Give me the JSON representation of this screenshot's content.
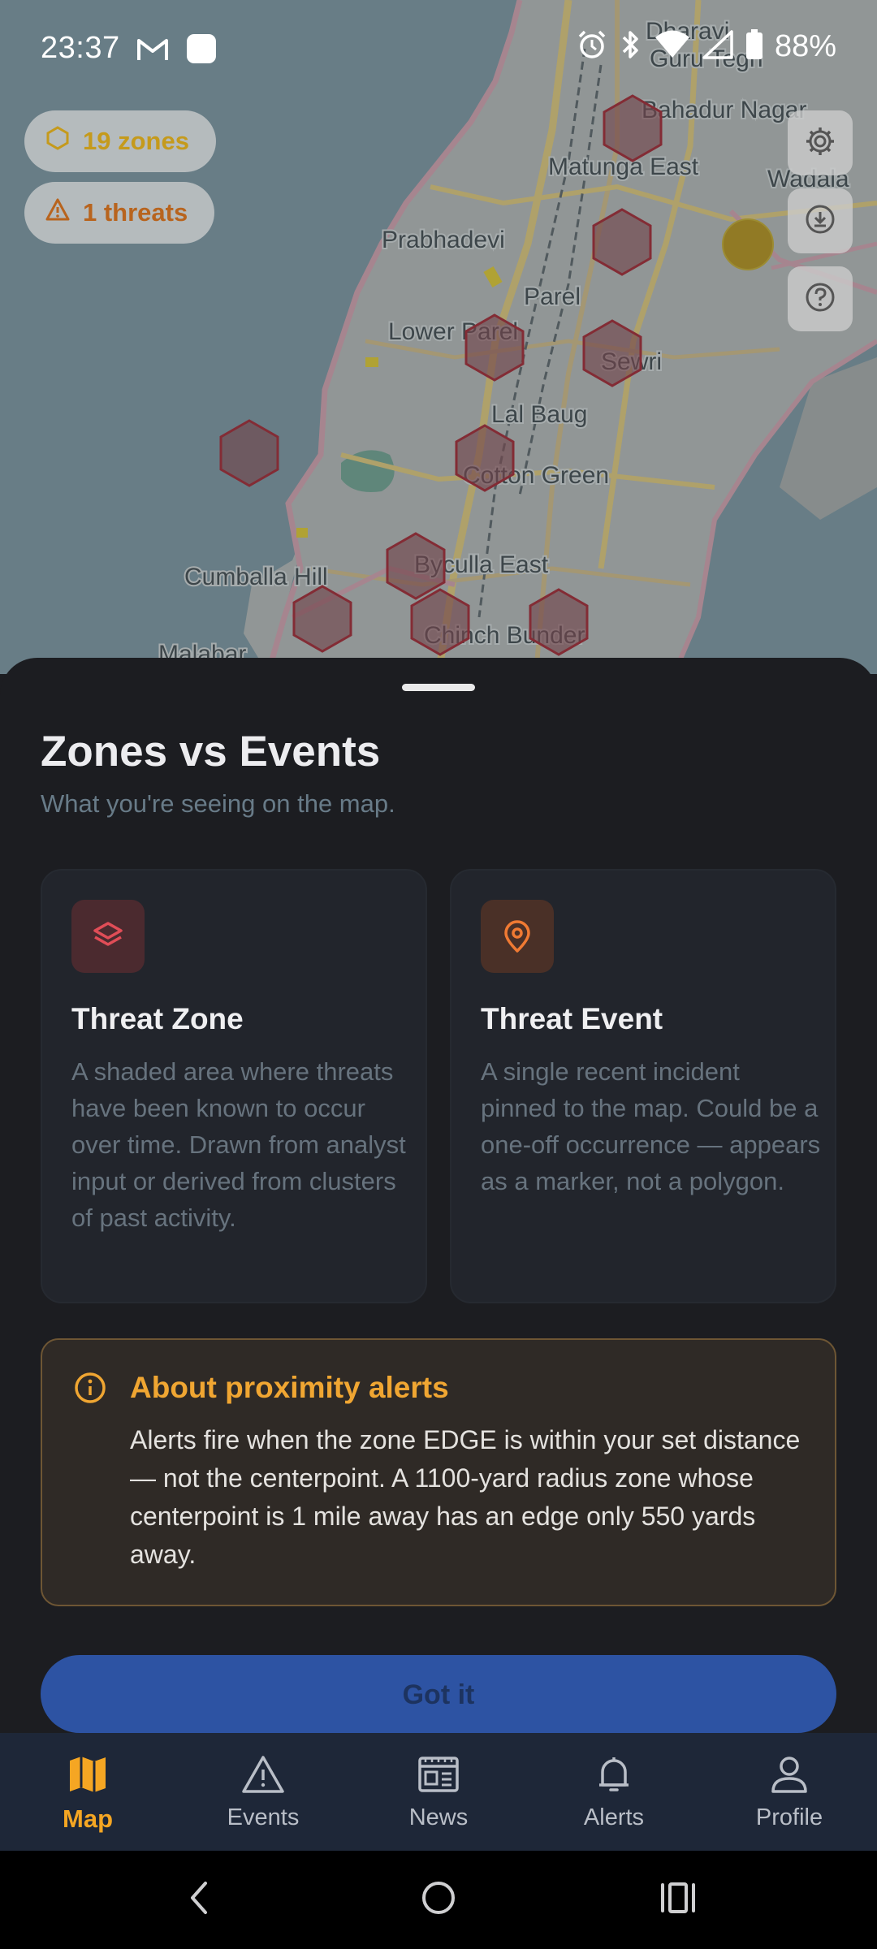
{
  "status_bar": {
    "time": "23:37",
    "battery": "88%"
  },
  "map": {
    "chips": {
      "zones": "19 zones",
      "threats": "1 threats"
    },
    "place_labels": [
      "Dharavi",
      "Guru Tegh",
      "Bahadur Nagar",
      "Matunga East",
      "Wadala",
      "Prabhadevi",
      "Parel",
      "Lower Parel",
      "Sewri",
      "Lal Baug",
      "Cotton Green",
      "Byculla East",
      "Cumballa Hill",
      "Chinch Bunder",
      "Malabar"
    ],
    "colors": {
      "zone_fill": "#8a3a3e",
      "zone_stroke": "#a4151d",
      "event_marker": "#b98a05"
    }
  },
  "sheet": {
    "title": "Zones vs Events",
    "subtitle": "What you're seeing on the map.",
    "cards": {
      "zone": {
        "icon": "layers-icon",
        "title": "Threat Zone",
        "body": "A shaded area where threats have been known to occur over time. Drawn from analyst input or derived from clusters of past activity."
      },
      "event": {
        "icon": "map-pin-icon",
        "title": "Threat Event",
        "body": "A single recent incident pinned to the map. Could be a one-off occurrence — appears as a marker, not a polygon."
      }
    },
    "notice": {
      "icon": "info-icon",
      "title": "About proximity alerts",
      "body": "Alerts fire when the zone EDGE is within your set distance — not the centerpoint. A 1100-yard radius zone whose centerpoint is 1 mile away has an edge only 550 yards away."
    },
    "button_label": "Got it"
  },
  "bottom_nav": {
    "items": [
      {
        "label": "Map",
        "icon": "map-icon",
        "active": true
      },
      {
        "label": "Events",
        "icon": "warning-triangle-icon"
      },
      {
        "label": "News",
        "icon": "newspaper-icon"
      },
      {
        "label": "Alerts",
        "icon": "bell-icon"
      },
      {
        "label": "Profile",
        "icon": "person-icon"
      }
    ],
    "active_color": "#f5a623"
  }
}
